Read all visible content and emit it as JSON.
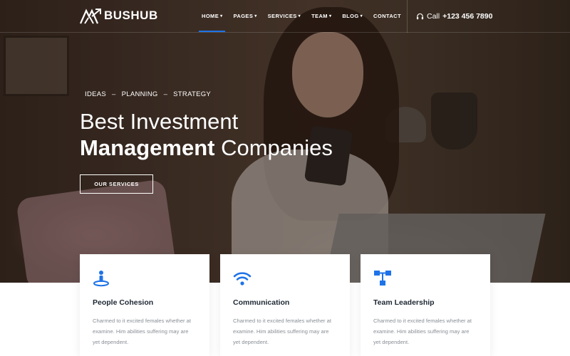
{
  "brand": {
    "name": "BUSHUB"
  },
  "nav": {
    "items": [
      {
        "label": "HOME",
        "dropdown": true
      },
      {
        "label": "PAGES",
        "dropdown": true
      },
      {
        "label": "SERVICES",
        "dropdown": true
      },
      {
        "label": "TEAM",
        "dropdown": true
      },
      {
        "label": "BLOG",
        "dropdown": true
      },
      {
        "label": "CONTACT",
        "dropdown": false
      }
    ],
    "active": "HOME",
    "call_label": "Call",
    "phone": "+123 456 7890"
  },
  "hero": {
    "tagline": [
      "IDEAS",
      "PLANNING",
      "STRATEGY"
    ],
    "tagline_separator": "–",
    "headline_line1": "Best Investment",
    "headline_bold": "Management",
    "headline_rest": " Companies",
    "cta_label": "OUR SERVICES"
  },
  "cards": [
    {
      "title": "People Cohesion",
      "icon": "person-pin-icon",
      "text": "Charmed to it excited females whether at examine. Him abilities suffering may are yet dependent."
    },
    {
      "title": "Communication",
      "icon": "wifi-icon",
      "text": "Charmed to it excited females whether at examine. Him abilities suffering may are yet dependent."
    },
    {
      "title": "Team Leadership",
      "icon": "hierarchy-icon",
      "text": "Charmed to it excited females whether at examine. Him abilities suffering may are yet dependent."
    }
  ],
  "colors": {
    "accent": "#1e73e8",
    "heading": "#1d2733",
    "body_text": "#8a8f96"
  }
}
